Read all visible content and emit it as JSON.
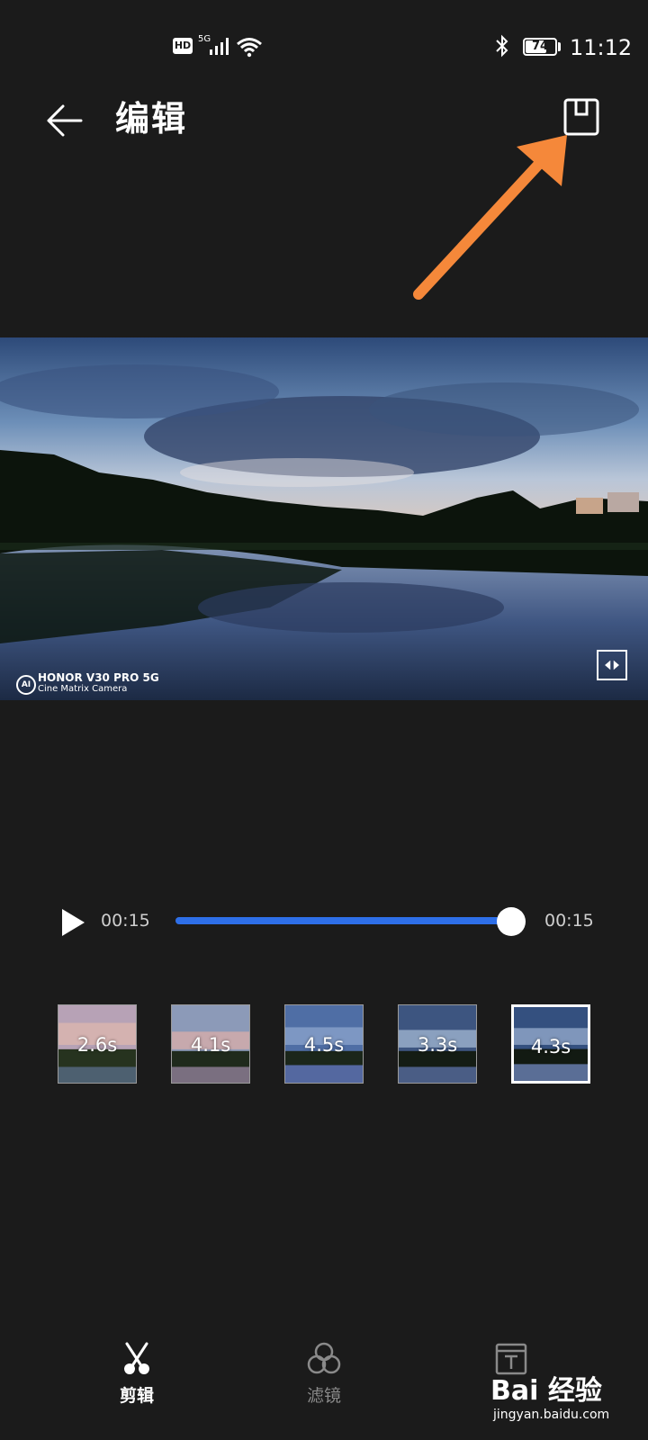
{
  "status_bar": {
    "hd": "HD",
    "network": "5G",
    "battery": "74",
    "battery_level": 0.74,
    "time": "11:12"
  },
  "header": {
    "title": "编辑",
    "back_icon": "arrow-left-icon",
    "save_icon": "save-icon"
  },
  "annotation": {
    "arrow_color": "#f5883a"
  },
  "preview": {
    "watermark_line1": "HONOR V30 PRO 5G",
    "watermark_line2": "Cine Matrix Camera",
    "watermark_logo": "AI",
    "compare_icon": "compare-icon"
  },
  "playback": {
    "time_start": "00:15",
    "time_end": "00:15",
    "progress": 1.0,
    "accent": "#2e6fe8"
  },
  "clips": [
    {
      "duration": "2.6s",
      "selected": false
    },
    {
      "duration": "4.1s",
      "selected": false
    },
    {
      "duration": "4.5s",
      "selected": false
    },
    {
      "duration": "3.3s",
      "selected": false
    },
    {
      "duration": "4.3s",
      "selected": true
    }
  ],
  "bottom_nav": [
    {
      "label": "剪辑",
      "icon": "scissors-icon",
      "active": true
    },
    {
      "label": "滤镜",
      "icon": "filter-icon",
      "active": false
    },
    {
      "label": "",
      "icon": "text-icon",
      "active": false
    }
  ],
  "watermark_site": {
    "brand": "Bai 经验",
    "url": "jingyan.baidu.com"
  }
}
